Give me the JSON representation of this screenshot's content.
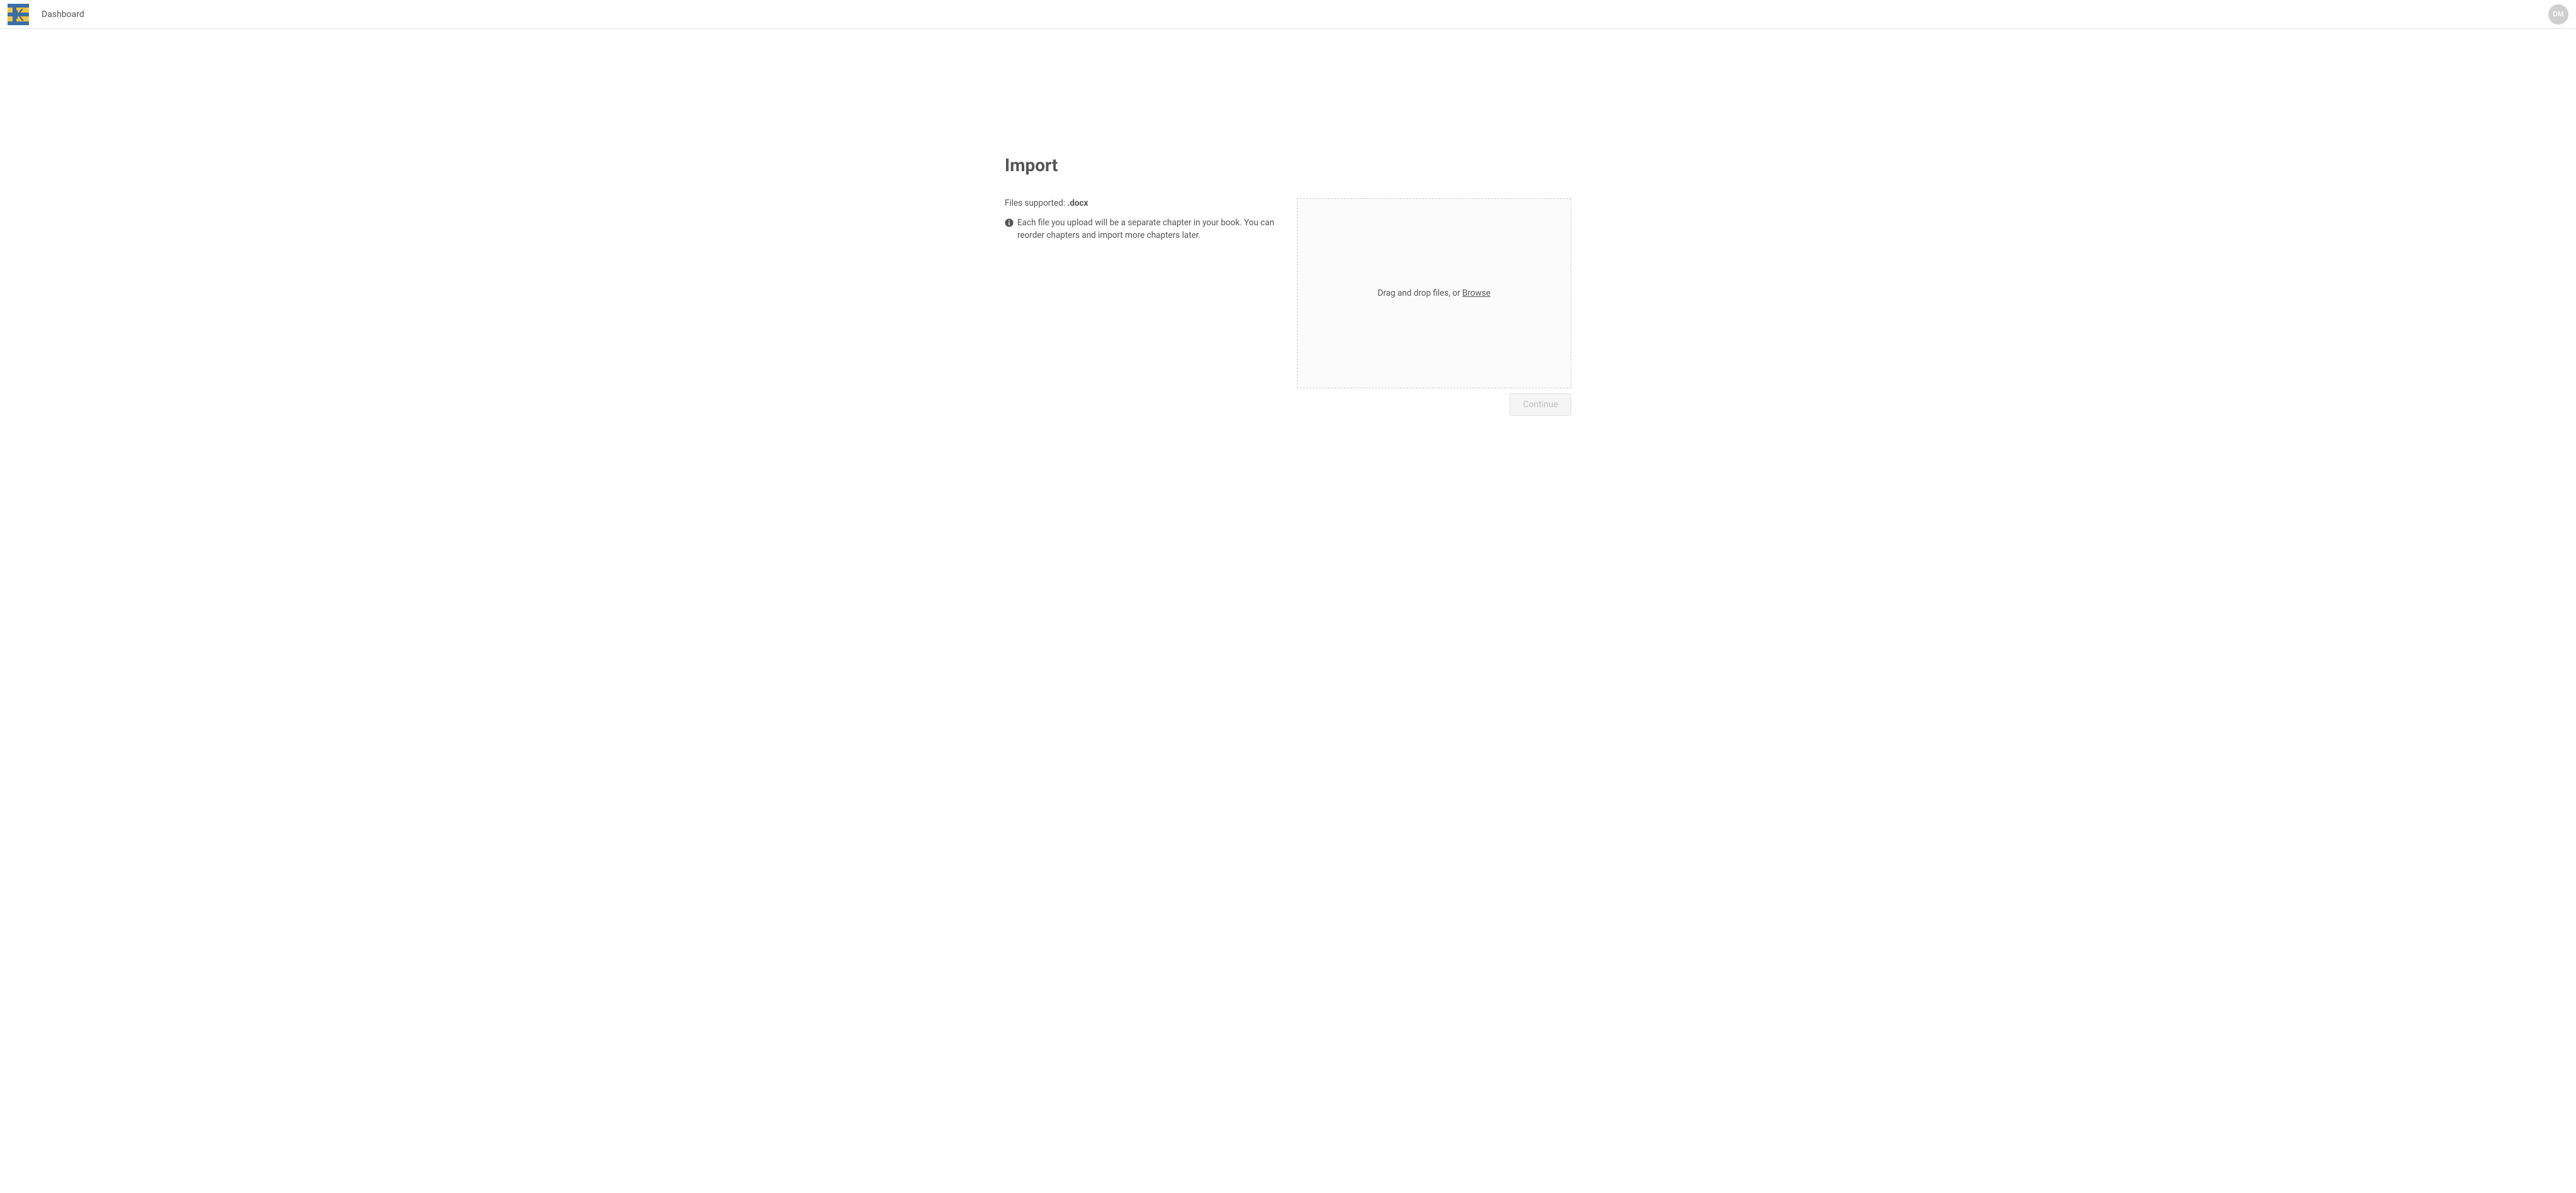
{
  "header": {
    "nav_dashboard": "Dashboard",
    "avatar_initials": "DM"
  },
  "import": {
    "title": "Import",
    "files_supported_label": "Files supported: ",
    "files_supported_ext": ".docx",
    "info_note": "Each file you upload will be a separate chapter in your book. You can reorder chapters and import more chapters later.",
    "dropzone_text": "Drag and drop files, or ",
    "browse_label": "Browse",
    "continue_label": "Continue"
  }
}
